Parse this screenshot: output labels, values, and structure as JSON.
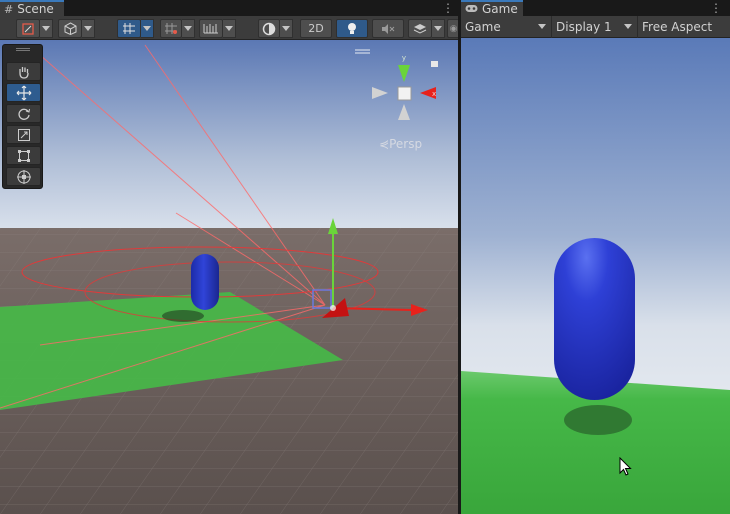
{
  "scene_tab": {
    "label": "Scene",
    "icon": "hash-grid-icon"
  },
  "game_tab": {
    "label": "Game",
    "icon": "gamepad-icon"
  },
  "scene_toolbar": {
    "view_2d_label": "2D",
    "items": [
      "shading-mode-icon",
      "draw-mode-icon",
      "grid-snap-icon",
      "increment-snap-icon",
      "ruler-icon",
      "render-mode-icon",
      "lighting-icon",
      "audio-icon",
      "effects-icon",
      "visibility-icon"
    ]
  },
  "scene": {
    "projection_label": "Persp",
    "gizmo_axes": [
      "x",
      "y",
      "z"
    ],
    "tools": [
      "hand-tool",
      "move-tool",
      "rotate-tool",
      "scale-tool",
      "rect-tool",
      "transform-tool"
    ],
    "active_tool": "move-tool"
  },
  "game_toolbar": {
    "view_select": "Game",
    "display_select": "Display 1",
    "aspect_select": "Free Aspect"
  },
  "colors": {
    "capsule": "#2a3cd0",
    "ground": "#46b848",
    "sky_top": "#5a7ab8",
    "sky_horizon": "#cfd8e6",
    "floor": "#6a5e5a",
    "x_axis": "#e8221c",
    "y_axis": "#6ad43a",
    "z_axis": "#3a5ae8"
  }
}
